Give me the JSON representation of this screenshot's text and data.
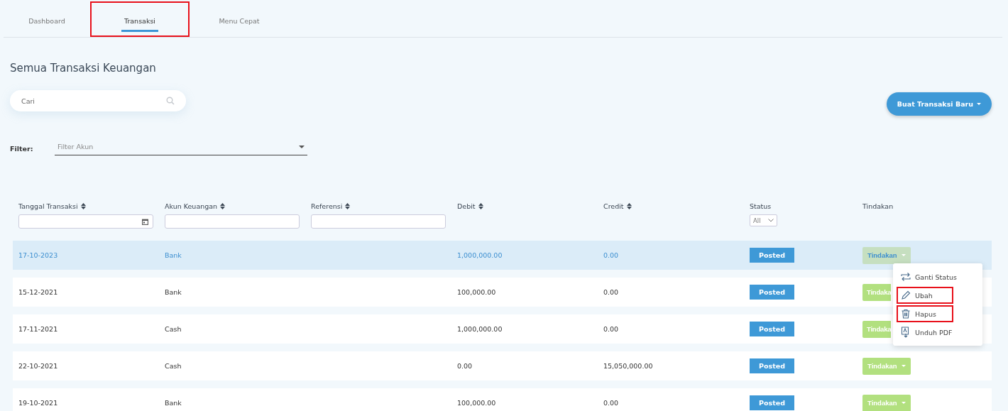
{
  "tabs": [
    {
      "label": "Dashboard",
      "selected": false,
      "highlighted": false
    },
    {
      "label": "Transaksi",
      "selected": true,
      "highlighted": true
    },
    {
      "label": "Menu Cepat",
      "selected": false,
      "highlighted": false
    }
  ],
  "title": "Semua Transaksi Keuangan",
  "search": {
    "placeholder": "Cari"
  },
  "new_button": "Buat Transaksi Baru",
  "filter": {
    "label": "Filter:",
    "placeholder": "Filter Akun"
  },
  "table": {
    "columns": [
      {
        "label": "Tanggal Transaksi",
        "sortable": true,
        "filter": {
          "kind": "date"
        }
      },
      {
        "label": "Akun Keuangan",
        "sortable": true,
        "filter": {
          "kind": "text"
        }
      },
      {
        "label": "Referensi",
        "sortable": true,
        "filter": {
          "kind": "text"
        }
      },
      {
        "label": "Debit",
        "sortable": true
      },
      {
        "label": "Credit",
        "sortable": true
      },
      {
        "label": "Status",
        "sortable": false,
        "filter": {
          "kind": "select",
          "value": "All"
        }
      },
      {
        "label": "Tindakan",
        "sortable": false
      }
    ],
    "rows": [
      {
        "date": "17-10-2023",
        "account": "Bank",
        "debit": "1,000,000.00",
        "credit": "0.00",
        "status": "Posted",
        "action": "Tindakan",
        "selected": true,
        "covered": false
      },
      {
        "date": "15-12-2021",
        "account": "Bank",
        "debit": "100,000.00",
        "credit": "0.00",
        "status": "Posted",
        "action": "Tindaka",
        "selected": false,
        "covered": true
      },
      {
        "date": "17-11-2021",
        "account": "Cash",
        "debit": "1,000,000.00",
        "credit": "0.00",
        "status": "Posted",
        "action": "Tindaka",
        "selected": false,
        "covered": true
      },
      {
        "date": "22-10-2021",
        "account": "Cash",
        "debit": "0.00",
        "credit": "15,050,000.00",
        "status": "Posted",
        "action": "Tindakan",
        "selected": false,
        "covered": false
      },
      {
        "date": "19-10-2021",
        "account": "Bank",
        "debit": "100,000.00",
        "credit": "0.00",
        "status": "Posted",
        "action": "Tindakan",
        "selected": false,
        "covered": false
      }
    ]
  },
  "action_menu": [
    {
      "label": "Ganti Status",
      "kind": "status",
      "highlighted": false
    },
    {
      "label": "Ubah",
      "kind": "edit",
      "highlighted": true
    },
    {
      "label": "Hapus",
      "kind": "delete",
      "highlighted": true
    },
    {
      "label": "Unduh PDF",
      "kind": "pdf",
      "highlighted": false
    }
  ]
}
